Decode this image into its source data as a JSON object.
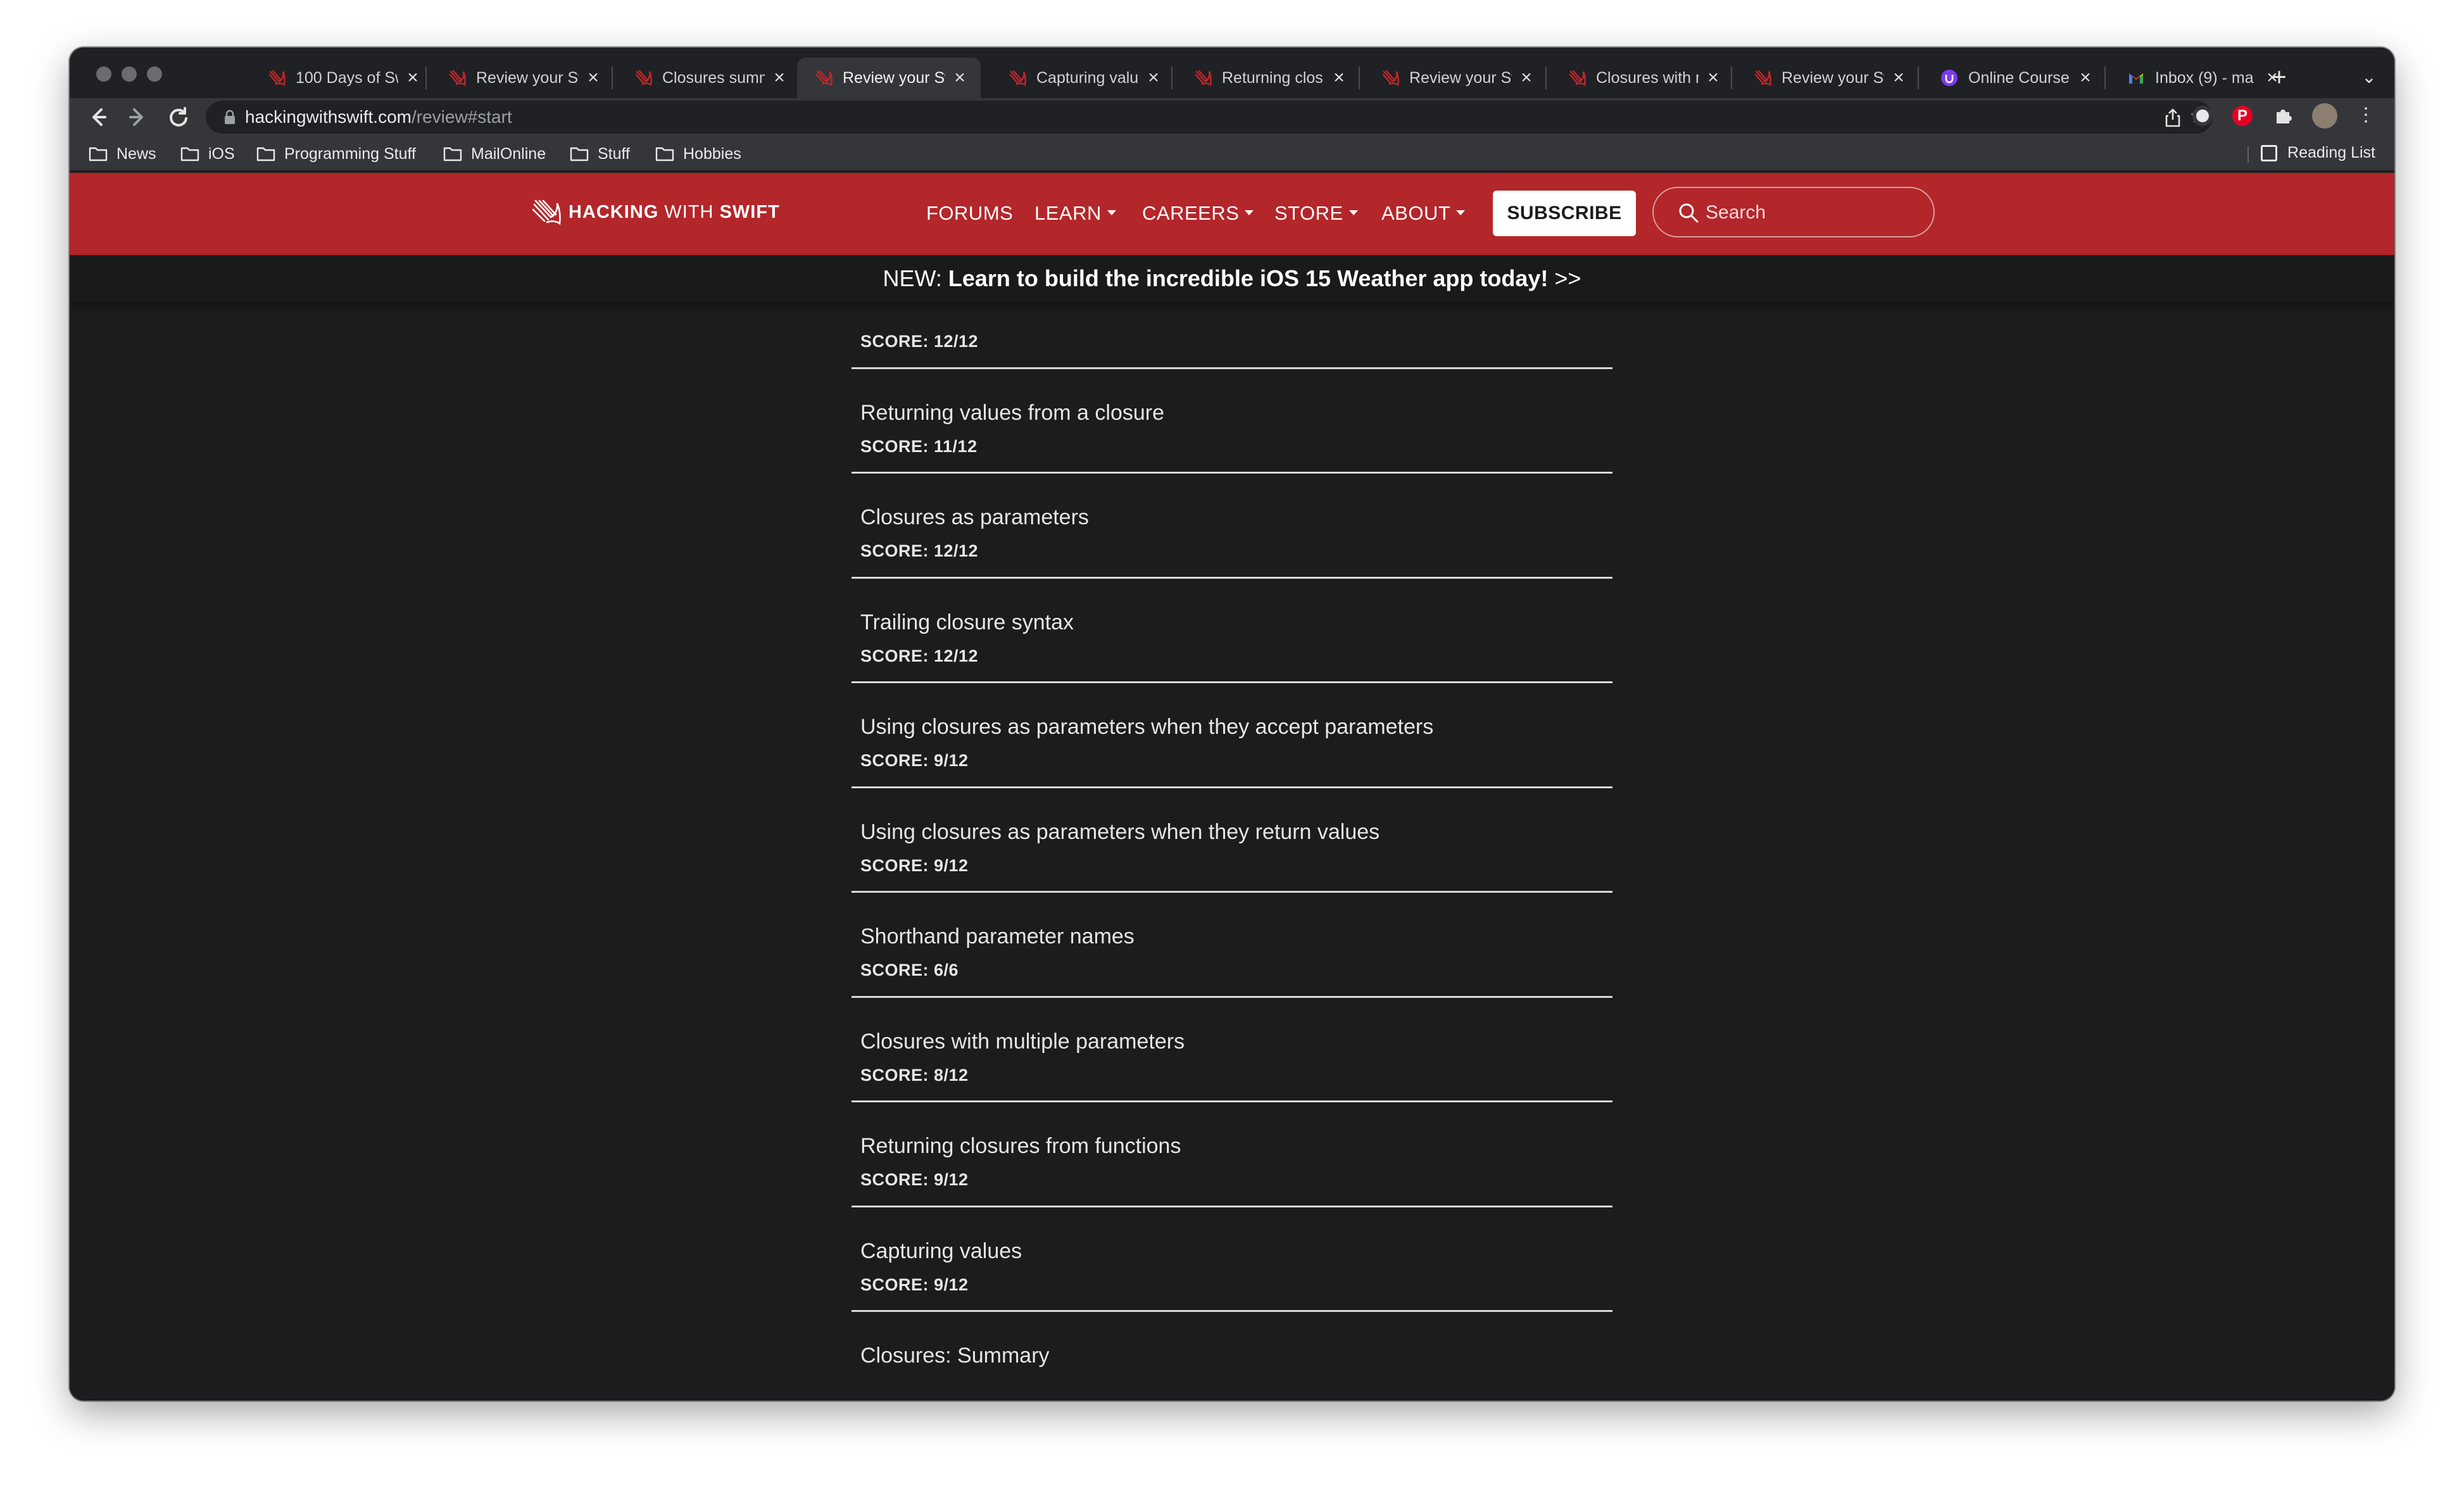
{
  "browser": {
    "tabs": [
      {
        "title": "100 Days of Sw",
        "icon": "hws-icon",
        "active": false
      },
      {
        "title": "Review your Sw",
        "icon": "hws-icon",
        "active": false
      },
      {
        "title": "Closures summ",
        "icon": "hws-icon",
        "active": false
      },
      {
        "title": "Review your Sw",
        "icon": "hws-icon",
        "active": true
      },
      {
        "title": "Capturing valu",
        "icon": "hws-icon",
        "active": false
      },
      {
        "title": "Returning clos",
        "icon": "hws-icon",
        "active": false
      },
      {
        "title": "Review your Sw",
        "icon": "hws-icon",
        "active": false
      },
      {
        "title": "Closures with m",
        "icon": "hws-icon",
        "active": false
      },
      {
        "title": "Review your Sw",
        "icon": "hws-icon",
        "active": false
      },
      {
        "title": "Online Course",
        "icon": "udemy-icon",
        "active": false
      },
      {
        "title": "Inbox (9) - ma",
        "icon": "gmail-icon",
        "active": false
      }
    ],
    "url_host": "hackingwithswift.com",
    "url_path": "/review#start",
    "bookmarks": [
      "News",
      "iOS",
      "Programming Stuff",
      "MailOnline",
      "Stuff",
      "Hobbies"
    ],
    "reading_list": "Reading List"
  },
  "site": {
    "logo_hacking": "HACKING",
    "logo_with": "WITH",
    "logo_swift": "SWIFT",
    "nav": {
      "forums": "FORUMS",
      "learn": "LEARN",
      "careers": "CAREERS",
      "store": "STORE",
      "about": "ABOUT"
    },
    "subscribe": "SUBSCRIBE",
    "search_placeholder": "Search",
    "announce_prefix": "NEW:",
    "announce_text": "Learn to build the incredible iOS 15 Weather app today!",
    "announce_suffix": ">>"
  },
  "reviews": [
    {
      "title": "",
      "score": "SCORE: 12/12"
    },
    {
      "title": "Returning values from a closure",
      "score": "SCORE: 11/12"
    },
    {
      "title": "Closures as parameters",
      "score": "SCORE: 12/12"
    },
    {
      "title": "Trailing closure syntax",
      "score": "SCORE: 12/12"
    },
    {
      "title": "Using closures as parameters when they accept parameters",
      "score": "SCORE: 9/12"
    },
    {
      "title": "Using closures as parameters when they return values",
      "score": "SCORE: 9/12"
    },
    {
      "title": "Shorthand parameter names",
      "score": "SCORE: 6/6"
    },
    {
      "title": "Closures with multiple parameters",
      "score": "SCORE: 8/12"
    },
    {
      "title": "Returning closures from functions",
      "score": "SCORE: 9/12"
    },
    {
      "title": "Capturing values",
      "score": "SCORE: 9/12"
    },
    {
      "title": "Closures: Summary",
      "score": ""
    }
  ],
  "colors": {
    "brand_red": "#b3262a",
    "page_bg": "#1c1c1e"
  }
}
